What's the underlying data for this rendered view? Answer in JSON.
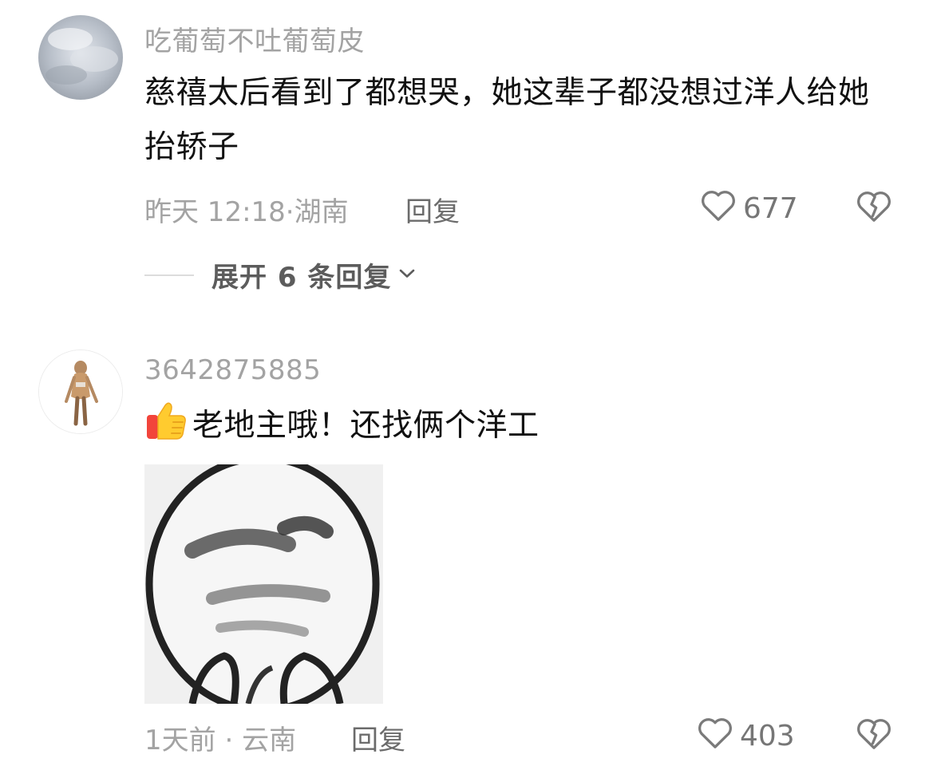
{
  "comments": [
    {
      "username": "吃葡萄不吐葡萄皮",
      "text": "慈禧太后看到了都想哭，她这辈子都没想过洋人给她抬轿子",
      "time": "昨天 12:18",
      "location": "湖南",
      "reply_label": "回复",
      "likes": "677",
      "expand_label": "展开 6 条回复"
    },
    {
      "username": "3642875885",
      "text": "老地主哦！还找俩个洋工",
      "time": "1天前",
      "location": "云南",
      "reply_label": "回复",
      "likes": "403"
    }
  ],
  "icons": {
    "like": "heart-outline-icon",
    "dislike": "broken-heart-icon",
    "expand": "chevron-down-icon",
    "thumbs_up": "thumbs-up-emoji"
  },
  "colors": {
    "username": "#a3a3a3",
    "body_text": "#111111",
    "meta": "#a3a3a3",
    "action": "#6b6b6b"
  }
}
